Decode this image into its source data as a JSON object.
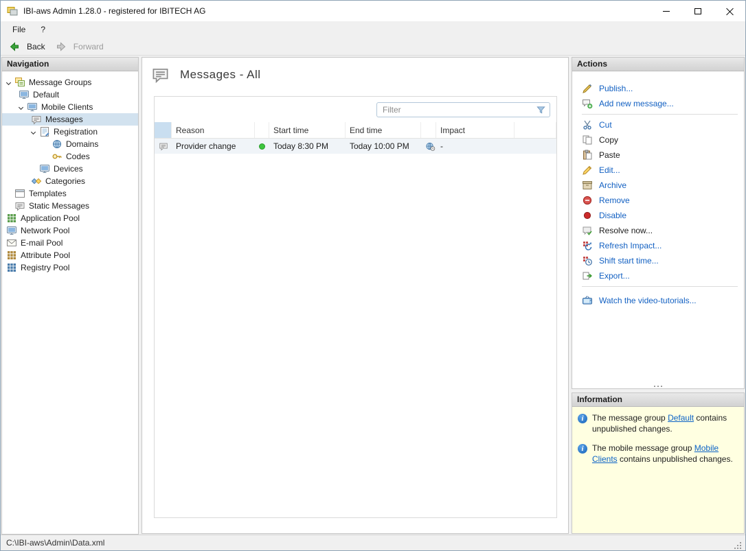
{
  "window": {
    "title": "IBI-aws Admin 1.28.0 - registered for IBITECH AG",
    "app_icon": "ibi-aws-app-icon"
  },
  "menu": {
    "items": [
      {
        "label": "File"
      },
      {
        "label": "?"
      }
    ]
  },
  "toolbar": {
    "back": {
      "label": "Back",
      "icon": "back-arrow-icon",
      "enabled": true
    },
    "forward": {
      "label": "Forward",
      "icon": "forward-arrow-icon",
      "enabled": false
    }
  },
  "navigation": {
    "header": "Navigation",
    "tree": [
      {
        "label": "Message Groups",
        "level": 0,
        "expander": "down",
        "icon": "message-groups-icon",
        "selected": false
      },
      {
        "label": "Default",
        "level": 1,
        "expander": "right",
        "icon": "monitor-icon",
        "selected": false
      },
      {
        "label": "Mobile Clients",
        "level": 1,
        "expander": "down",
        "icon": "monitor-icon",
        "selected": false
      },
      {
        "label": "Messages",
        "level": 2,
        "expander": "right",
        "icon": "messages-icon",
        "selected": true
      },
      {
        "label": "Registration",
        "level": 2,
        "expander": "down",
        "icon": "registration-icon",
        "selected": false
      },
      {
        "label": "Domains",
        "level": 3,
        "expander": "none",
        "icon": "globe-icon",
        "selected": false
      },
      {
        "label": "Codes",
        "level": 3,
        "expander": "none",
        "icon": "key-icon",
        "selected": false
      },
      {
        "label": "Devices",
        "level": 2,
        "expander": "none",
        "icon": "monitor-icon",
        "selected": false
      },
      {
        "label": "Categories",
        "level": 2,
        "expander": "right",
        "icon": "tags-icon",
        "selected": false
      },
      {
        "label": "Templates",
        "level": 0,
        "expander": "none",
        "icon": "window-icon",
        "selected": false
      },
      {
        "label": "Static Messages",
        "level": 0,
        "expander": "none",
        "icon": "messages-icon",
        "selected": false
      },
      {
        "label": "Application Pool",
        "level": 0,
        "expander": "right",
        "icon": "grid-icon",
        "selected": false
      },
      {
        "label": "Network Pool",
        "level": 0,
        "expander": "right",
        "icon": "monitor-icon",
        "selected": false
      },
      {
        "label": "E-mail Pool",
        "level": 0,
        "expander": "right",
        "icon": "mail-icon",
        "selected": false
      },
      {
        "label": "Attribute Pool",
        "level": 0,
        "expander": "right",
        "icon": "grid-icon",
        "selected": false
      },
      {
        "label": "Registry Pool",
        "level": 0,
        "expander": "right",
        "icon": "grid-icon",
        "selected": false
      }
    ]
  },
  "main": {
    "title": "Messages - All",
    "title_icon": "messages-icon",
    "filter": {
      "placeholder": "Filter",
      "icon": "filter-funnel-icon"
    },
    "table": {
      "columns": {
        "reason": "Reason",
        "start": "Start time",
        "end": "End time",
        "impact": "Impact"
      },
      "rows": [
        {
          "icon": "message-icon",
          "reason": "Provider change",
          "status_icon": "green-status-dot",
          "start": "Today 8:30 PM",
          "end": "Today 10:00 PM",
          "impact_icon": "globe-clock-icon",
          "impact": "-"
        }
      ]
    }
  },
  "actions": {
    "header": "Actions",
    "link_color": "#1260c2",
    "items": [
      {
        "label": "Publish...",
        "icon": "publish-icon",
        "color": "#1260c2"
      },
      {
        "label": "Add new message...",
        "icon": "add-message-icon",
        "color": "#1260c2"
      },
      {
        "label": "Cut",
        "icon": "cut-icon",
        "color": "#1260c2"
      },
      {
        "label": "Copy",
        "icon": "copy-icon",
        "color": "#1c1c1c"
      },
      {
        "label": "Paste",
        "icon": "paste-icon",
        "color": "#1c1c1c"
      },
      {
        "label": "Edit...",
        "icon": "edit-icon",
        "color": "#1260c2"
      },
      {
        "label": "Archive",
        "icon": "archive-icon",
        "color": "#1260c2"
      },
      {
        "label": "Remove",
        "icon": "remove-icon",
        "color": "#1260c2"
      },
      {
        "label": "Disable",
        "icon": "disable-icon",
        "color": "#1260c2"
      },
      {
        "label": "Resolve now...",
        "icon": "resolve-icon",
        "color": "#1c1c1c"
      },
      {
        "label": "Refresh Impact...",
        "icon": "refresh-impact-icon",
        "color": "#1260c2"
      },
      {
        "label": "Shift start time...",
        "icon": "shift-start-time-icon",
        "color": "#1260c2"
      },
      {
        "label": "Export...",
        "icon": "export-icon",
        "color": "#1260c2"
      },
      {
        "label": "Watch the video-tutorials...",
        "icon": "video-tutorials-icon",
        "color": "#1260c2"
      }
    ]
  },
  "information": {
    "header": "Information",
    "background": "#ffffe1",
    "items": [
      {
        "prefix": "The message group ",
        "link": "Default",
        "suffix": " contains unpublished changes."
      },
      {
        "prefix": "The mobile message group ",
        "link": "Mobile Clients",
        "suffix": " contains unpublished changes."
      }
    ]
  },
  "status_bar": {
    "path": "C:\\IBI-aws\\Admin\\Data.xml"
  }
}
